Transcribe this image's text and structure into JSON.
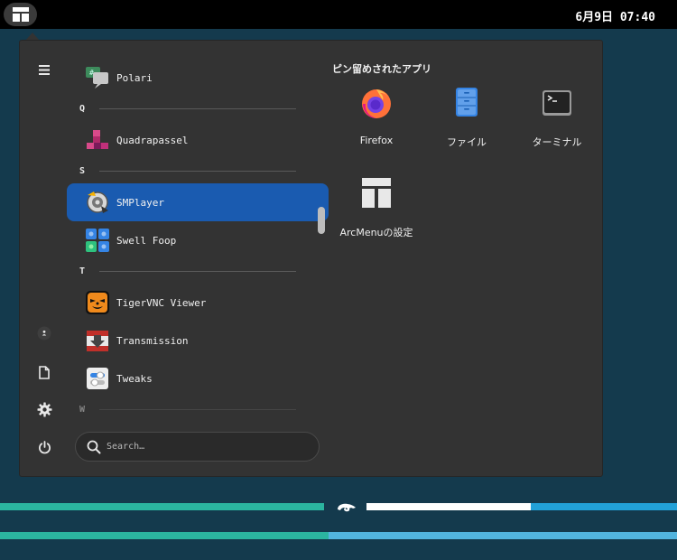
{
  "topbar": {
    "clock": "6月9日 07:40",
    "activities_icon": "layout-icon"
  },
  "menu": {
    "rail": [
      {
        "name": "hamburger-icon"
      },
      {
        "name": "user-icon"
      },
      {
        "name": "document-icon"
      },
      {
        "name": "gear-icon"
      },
      {
        "name": "power-icon"
      }
    ],
    "apps": [
      {
        "label": "Polari",
        "icon": "polari-icon"
      },
      {
        "section": "Q"
      },
      {
        "label": "Quadrapassel",
        "icon": "quadrapassel-icon"
      },
      {
        "section": "S"
      },
      {
        "label": "SMPlayer",
        "icon": "smplayer-icon",
        "selected": true
      },
      {
        "label": "Swell Foop",
        "icon": "swell-foop-icon"
      },
      {
        "section": "T"
      },
      {
        "label": "TigerVNC Viewer",
        "icon": "tigervnc-icon"
      },
      {
        "label": "Transmission",
        "icon": "transmission-icon"
      },
      {
        "label": "Tweaks",
        "icon": "tweaks-icon"
      },
      {
        "section": "W"
      }
    ],
    "search": {
      "placeholder": "Search…",
      "value": ""
    },
    "pinned": {
      "title": "ピン留めされたアプリ",
      "items": [
        {
          "label": "Firefox",
          "icon": "firefox-icon"
        },
        {
          "label": "ファイル",
          "icon": "files-icon"
        },
        {
          "label": "ターミナル",
          "icon": "terminal-icon"
        },
        {
          "label": "ArcMenuの設定",
          "icon": "arcmenu-settings-icon"
        }
      ]
    }
  },
  "colors": {
    "selected": "#1a5bb0",
    "menu_bg": "#333333",
    "desktop_bg": "#143a4d",
    "stripe_teal": "#2bb5a0",
    "stripe_blue": "#22a1d8"
  }
}
